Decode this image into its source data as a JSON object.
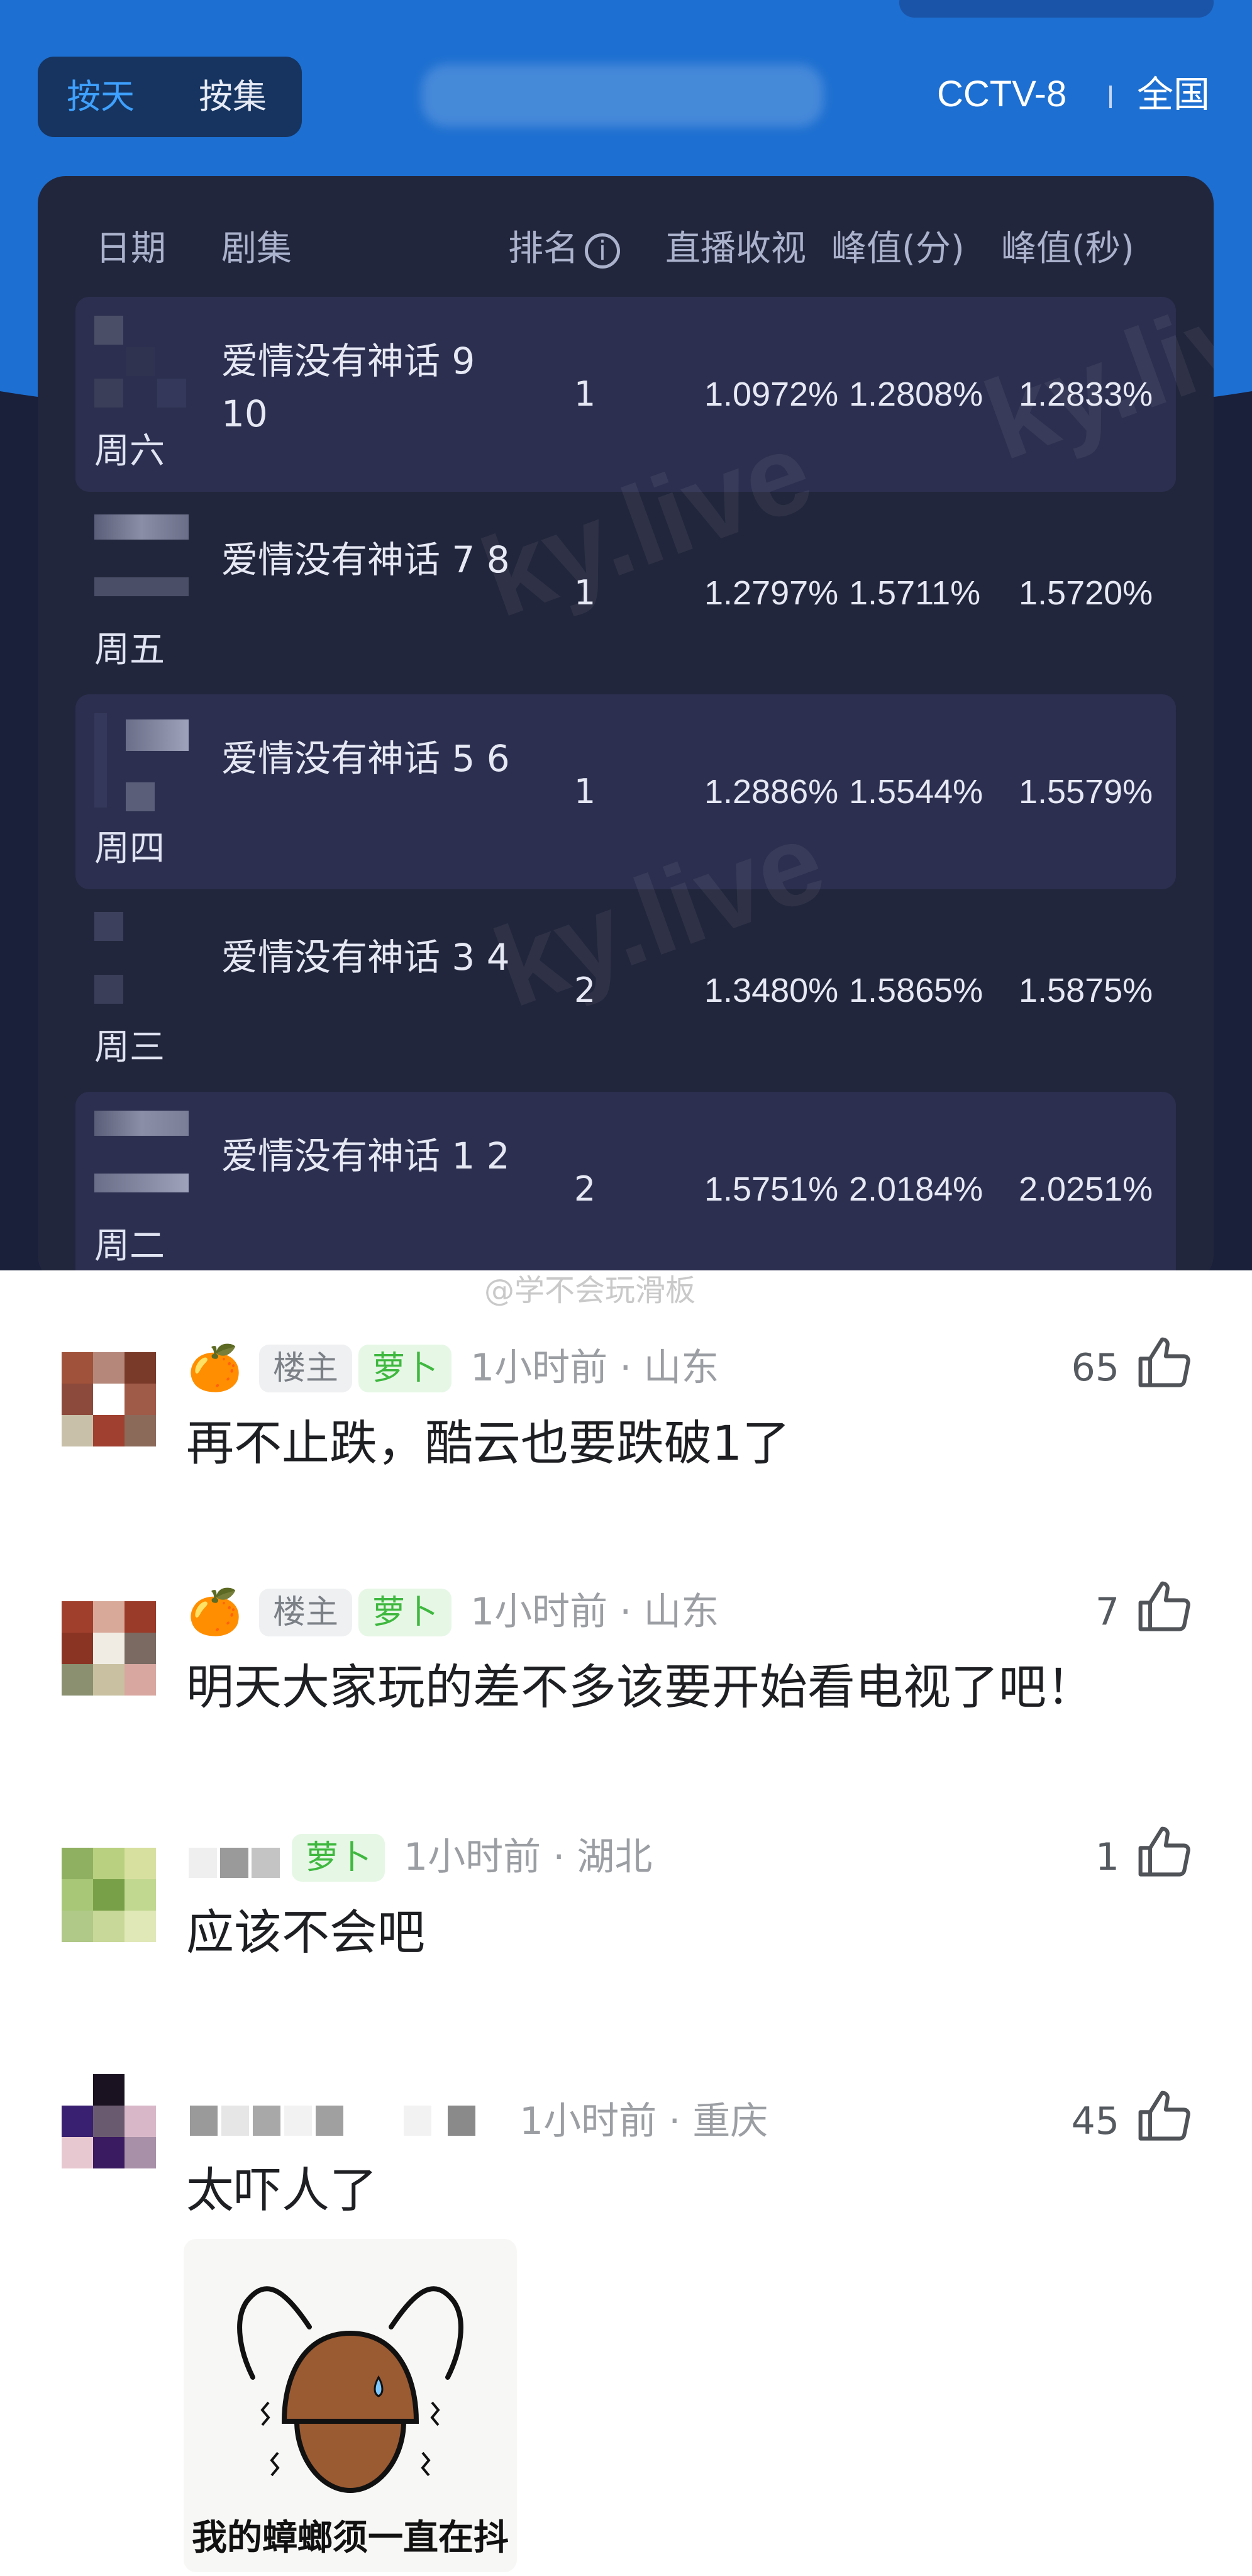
{
  "header": {
    "toggle": {
      "active": "按天",
      "inactive": "按集"
    },
    "channel": "CCTV-8",
    "region": "全国"
  },
  "table": {
    "headers": {
      "date": "日期",
      "episode": "剧集",
      "rank": "排名",
      "live": "直播收视",
      "peak_min": "峰值(分)",
      "peak_sec": "峰值(秒)"
    },
    "rows": [
      {
        "weekday": "周六",
        "title": "爱情没有神话 9 10",
        "rank": "1",
        "live": "1.0972%",
        "peak_min": "1.2808%",
        "peak_sec": "1.2833%"
      },
      {
        "weekday": "周五",
        "title": "爱情没有神话 7 8",
        "rank": "1",
        "live": "1.2797%",
        "peak_min": "1.5711%",
        "peak_sec": "1.5720%"
      },
      {
        "weekday": "周四",
        "title": "爱情没有神话 5 6",
        "rank": "1",
        "live": "1.2886%",
        "peak_min": "1.5544%",
        "peak_sec": "1.5579%"
      },
      {
        "weekday": "周三",
        "title": "爱情没有神话 3 4",
        "rank": "2",
        "live": "1.3480%",
        "peak_min": "1.5865%",
        "peak_sec": "1.5875%"
      },
      {
        "weekday": "周二",
        "title": "爱情没有神话 1 2",
        "rank": "2",
        "live": "1.5751%",
        "peak_min": "2.0184%",
        "peak_sec": "2.0251%"
      }
    ],
    "watermark": "ky.live"
  },
  "weibo_watermark": "@学不会玩滑板",
  "comments": [
    {
      "badge_owner": "楼主",
      "badge_level": "萝卜",
      "time": "1小时前 · 山东",
      "likes": "65",
      "text": "再不止跌，酷云也要跌破1了"
    },
    {
      "badge_owner": "楼主",
      "badge_level": "萝卜",
      "time": "1小时前 · 山东",
      "likes": "7",
      "text": "明天大家玩的差不多该要开始看电视了吧！"
    },
    {
      "badge_level": "萝卜",
      "time": "1小时前 · 湖北",
      "likes": "1",
      "text": "应该不会吧"
    },
    {
      "time": "1小时前 · 重庆",
      "likes": "45",
      "text": "太吓人了",
      "sticker_caption": "我的蟑螂须一直在抖"
    }
  ],
  "colors": {
    "accent_blue": "#1d6fd1",
    "panel_bg": "#22263c",
    "tag_green": "#3fb83f"
  }
}
